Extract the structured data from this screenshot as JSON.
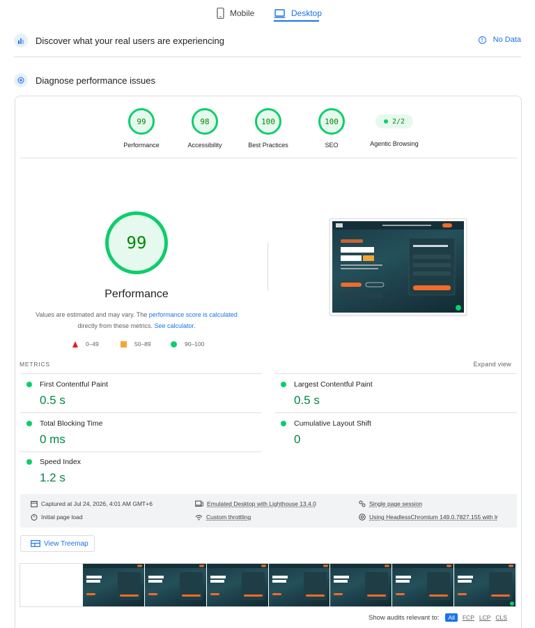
{
  "tabs": [
    {
      "label": "Mobile",
      "active": false
    },
    {
      "label": "Desktop",
      "active": true
    }
  ],
  "field_data": {
    "title": "Discover what your real users are experiencing",
    "no_data_label": "No Data"
  },
  "diagnose": {
    "title": "Diagnose performance issues"
  },
  "categories": [
    {
      "score": "99",
      "label": "Performance"
    },
    {
      "score": "98",
      "label": "Accessibility"
    },
    {
      "score": "100",
      "label": "Best Practices"
    },
    {
      "score": "100",
      "label": "SEO"
    },
    {
      "score": "2/2",
      "label": "Agentic Browsing"
    }
  ],
  "performance": {
    "score": "99",
    "title": "Performance",
    "note_prefix": "Values are estimated and may vary. The ",
    "note_link1": "performance score is calculated",
    "note_middle": " directly from these metrics. ",
    "note_link2": "See calculator."
  },
  "legend": [
    {
      "range": "0–49",
      "color": "#e01b24"
    },
    {
      "range": "50–89",
      "color": "#f4a633"
    },
    {
      "range": "90–100",
      "color": "#0cce6b"
    }
  ],
  "metrics": {
    "label": "METRICS",
    "expand_label": "Expand view",
    "items": [
      {
        "name": "First Contentful Paint",
        "value": "0.5 s"
      },
      {
        "name": "Largest Contentful Paint",
        "value": "0.5 s"
      },
      {
        "name": "Total Blocking Time",
        "value": "0 ms"
      },
      {
        "name": "Cumulative Layout Shift",
        "value": "0"
      },
      {
        "name": "Speed Index",
        "value": "1.2 s"
      }
    ]
  },
  "run_info": {
    "captured": "Captured at Jul 24, 2026, 4:01 AM GMT+6",
    "page_load": "Initial page load",
    "emulated": "Emulated Desktop with Lighthouse 13.4.0",
    "throttling": "Custom throttling",
    "session": "Single page session",
    "browser": "Using HeadlessChromium 149.0.7827.155 with lr"
  },
  "treemap_label": "View Treemap",
  "audit_filter": {
    "label": "Show audits relevant to:",
    "chips": [
      "All",
      "FCP",
      "LCP",
      "CLS"
    ]
  },
  "colors": {
    "accent": "#1a73e8",
    "pass": "#0cce6b",
    "pass_text": "#018642"
  }
}
